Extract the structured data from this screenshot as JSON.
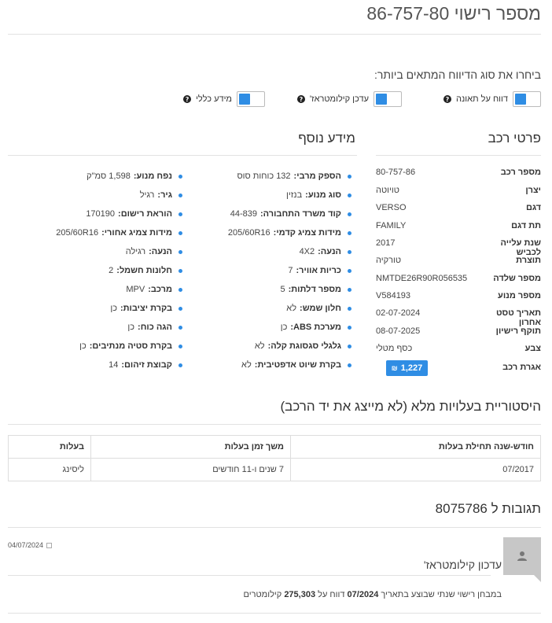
{
  "header": {
    "plate_title": "מספר רישוי 86-757-80"
  },
  "report_choice": {
    "prompt": "ביחרו את סוג הדיווח המתאים ביותר:",
    "options": [
      {
        "label": "דווח על תאונה"
      },
      {
        "label": "עדכן קילומטראז'"
      },
      {
        "label": "מידע כללי"
      }
    ]
  },
  "vehicle_details": {
    "heading": "פרטי רכב",
    "rows": [
      {
        "label": "מספר רכב",
        "value": "80-757-86"
      },
      {
        "label": "יצרן",
        "value": "טויוטה"
      },
      {
        "label": "דגם",
        "value": "VERSO"
      },
      {
        "label": "תת דגם",
        "value": "FAMILY"
      },
      {
        "label": "שנת עלייה לכביש",
        "value": "2017"
      },
      {
        "label": "תוצרת",
        "value": "טורקיה"
      },
      {
        "label": "מספר שלדה",
        "value": "NMTDE26R90R056535"
      },
      {
        "label": "מספר מנוע",
        "value": "V584193"
      },
      {
        "label": "תאריך טסט אחרון",
        "value": "02-07-2024"
      },
      {
        "label": "תוקף רישיון",
        "value": "08-07-2025"
      },
      {
        "label": "צבע",
        "value": "כסף מטלי"
      },
      {
        "label": "אגרת רכב",
        "value": "1,227",
        "currency": "₪"
      }
    ]
  },
  "extra_info": {
    "heading": "מידע נוסף",
    "col_right": [
      {
        "label": "הספק מרבי:",
        "value": "132 כוחות סוס"
      },
      {
        "label": "סוג מנוע:",
        "value": "בנזין"
      },
      {
        "label": "קוד משרד התחבורה:",
        "value": "44-839"
      },
      {
        "label": "מידות צמיג קדמי:",
        "value": "205/60R16"
      },
      {
        "label": "הנעה:",
        "value": "4X2"
      },
      {
        "label": "כריות אוויר:",
        "value": "7"
      },
      {
        "label": "מספר דלתות:",
        "value": "5"
      },
      {
        "label": "חלון שמש:",
        "value": "לא"
      },
      {
        "label": "מערכת ABS:",
        "value": "כן"
      },
      {
        "label": "גלגלי סגסוגת קלה:",
        "value": "לא"
      },
      {
        "label": "בקרת שיוט אדפטיבית:",
        "value": "לא"
      }
    ],
    "col_left": [
      {
        "label": "נפח מנוע:",
        "value": "1,598 סמ\"ק"
      },
      {
        "label": "גיר:",
        "value": "רגיל"
      },
      {
        "label": "הוראת רישום:",
        "value": "170190"
      },
      {
        "label": "מידות צמיג אחורי:",
        "value": "205/60R16"
      },
      {
        "label": "הנעה:",
        "value": "רגילה"
      },
      {
        "label": "חלונות חשמל:",
        "value": "2"
      },
      {
        "label": "מרכב:",
        "value": "MPV"
      },
      {
        "label": "בקרת יציבות:",
        "value": "כן"
      },
      {
        "label": "הגה כוח:",
        "value": "כן"
      },
      {
        "label": "בקרת סטיה מנתיבים:",
        "value": "כן"
      },
      {
        "label": "קבוצת זיהום:",
        "value": "14"
      }
    ]
  },
  "ownership": {
    "heading": "היסטוריית בעלויות מלא (לא מייצג את יד הרכב)",
    "columns": [
      "חודש-שנה תחילת בעלות",
      "משך זמן בעלות",
      "בעלות"
    ],
    "rows": [
      [
        "07/2017",
        "7 שנים ו-11 חודשים",
        "ליסינג"
      ]
    ]
  },
  "comments": {
    "heading": "תגובות ל 8075786",
    "items": [
      {
        "date": "04/07/2024",
        "title": "עדכון קילומטראז'",
        "body_prefix": "במבחן רישוי שנתי שבוצע בתאריך",
        "body_date": "07/2024",
        "body_mid": "דווח על",
        "body_km": "275,303",
        "body_suffix": "קילומטרים"
      }
    ]
  },
  "colors": {
    "accent": "#2f8de4",
    "avatar_bg": "#c7c7c7"
  },
  "icons": [
    "question-icon",
    "shekel-icon",
    "calendar-icon",
    "user-icon"
  ]
}
